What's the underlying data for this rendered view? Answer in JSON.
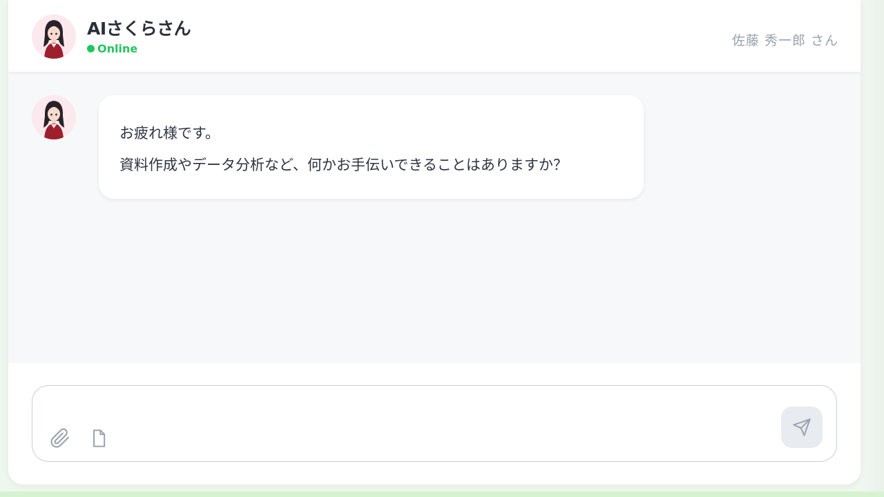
{
  "header": {
    "bot_name": "AIさくらさん",
    "status": "Online",
    "user_name": "佐藤 秀一郎 さん"
  },
  "messages": [
    {
      "sender": "bot",
      "lines": [
        "お疲れ様です。",
        "資料作成やデータ分析など、何かお手伝いできることはありますか？"
      ]
    }
  ],
  "composer": {
    "value": "",
    "placeholder": "",
    "icons": [
      "paperclip-icon",
      "document-icon",
      "send-icon"
    ]
  },
  "colors": {
    "online": "#22c55e",
    "window_bg": "#f7f8fa",
    "bubble_bg": "#ffffff",
    "avatar_bg": "#fbe9ee",
    "send_button_bg": "#e8ebf0"
  }
}
